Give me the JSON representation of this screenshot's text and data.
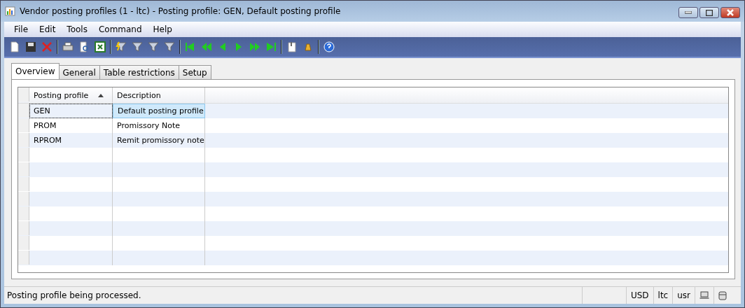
{
  "window": {
    "title": "Vendor posting profiles (1 - ltc) - Posting profile: GEN, Default posting profile"
  },
  "menu": [
    "File",
    "Edit",
    "Tools",
    "Command",
    "Help"
  ],
  "tabs": [
    {
      "label": "Overview",
      "selected": true
    },
    {
      "label": "General",
      "selected": false
    },
    {
      "label": "Table restrictions",
      "selected": false
    },
    {
      "label": "Setup",
      "selected": false
    }
  ],
  "table": {
    "columns": [
      {
        "label": "Posting profile",
        "sorted": true
      },
      {
        "label": "Description",
        "sorted": false
      }
    ],
    "rows": [
      {
        "cells": [
          "GEN",
          "Default posting profile"
        ],
        "selected": true
      },
      {
        "cells": [
          "PROM",
          "Promissory Note"
        ],
        "selected": false
      },
      {
        "cells": [
          "RPROM",
          "Remit promissory note"
        ],
        "selected": false
      }
    ]
  },
  "status_bar": {
    "message": "Posting profile being processed.",
    "fields": [
      "USD",
      "ltc",
      "usr"
    ]
  }
}
